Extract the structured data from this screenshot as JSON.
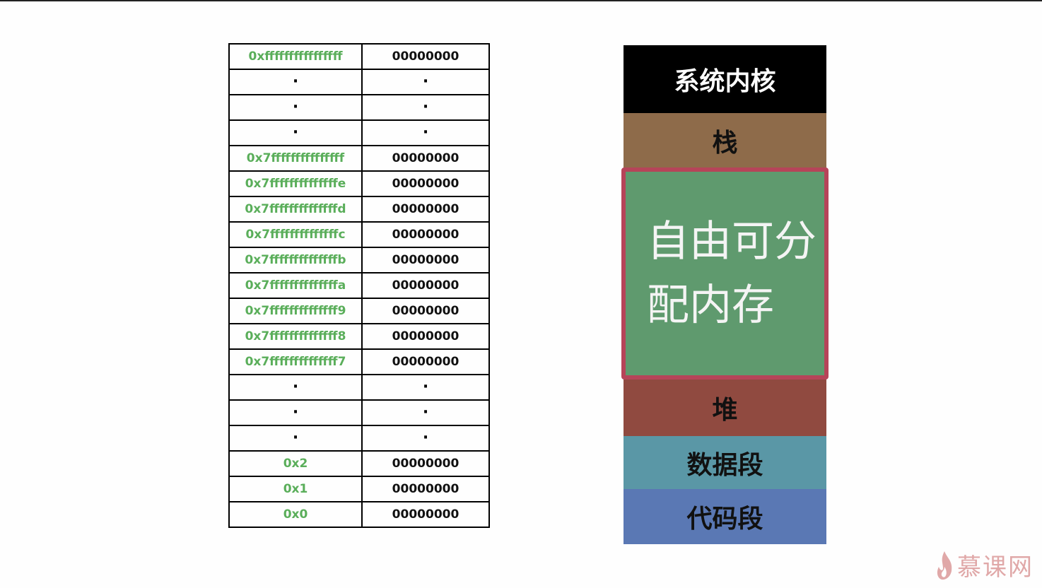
{
  "memory_table": {
    "rows": [
      {
        "addr": "0xffffffffffffffff",
        "value": "00000000",
        "type": "entry"
      },
      {
        "addr": "·",
        "value": "·",
        "type": "ellipsis"
      },
      {
        "addr": "·",
        "value": "·",
        "type": "ellipsis"
      },
      {
        "addr": "·",
        "value": "·",
        "type": "ellipsis"
      },
      {
        "addr": "0x7fffffffffffffff",
        "value": "00000000",
        "type": "entry"
      },
      {
        "addr": "0x7ffffffffffffffe",
        "value": "00000000",
        "type": "entry"
      },
      {
        "addr": "0x7ffffffffffffffd",
        "value": "00000000",
        "type": "entry"
      },
      {
        "addr": "0x7ffffffffffffffc",
        "value": "00000000",
        "type": "entry"
      },
      {
        "addr": "0x7ffffffffffffffb",
        "value": "00000000",
        "type": "entry"
      },
      {
        "addr": "0x7ffffffffffffffa",
        "value": "00000000",
        "type": "entry"
      },
      {
        "addr": "0x7ffffffffffffff9",
        "value": "00000000",
        "type": "entry"
      },
      {
        "addr": "0x7ffffffffffffff8",
        "value": "00000000",
        "type": "entry"
      },
      {
        "addr": "0x7ffffffffffffff7",
        "value": "00000000",
        "type": "entry"
      },
      {
        "addr": "·",
        "value": "·",
        "type": "ellipsis"
      },
      {
        "addr": "·",
        "value": "·",
        "type": "ellipsis"
      },
      {
        "addr": "·",
        "value": "·",
        "type": "ellipsis"
      },
      {
        "addr": "0x2",
        "value": "00000000",
        "type": "entry"
      },
      {
        "addr": "0x1",
        "value": "00000000",
        "type": "entry"
      },
      {
        "addr": "0x0",
        "value": "00000000",
        "type": "entry"
      }
    ]
  },
  "memory_layout": {
    "kernel": "系统内核",
    "stack": "栈",
    "free_line1": "自由可分",
    "free_line2": "配内存",
    "heap": "堆",
    "data": "数据段",
    "code": "代码段",
    "colors": {
      "kernel": "#000000",
      "stack": "#8e6b4a",
      "free": "#5f9a6e",
      "free_border": "#b64459",
      "heap": "#904a40",
      "data": "#5a97a6",
      "code": "#5a78b4"
    }
  },
  "watermark": {
    "text": "慕课网",
    "icon": "flame-icon"
  }
}
